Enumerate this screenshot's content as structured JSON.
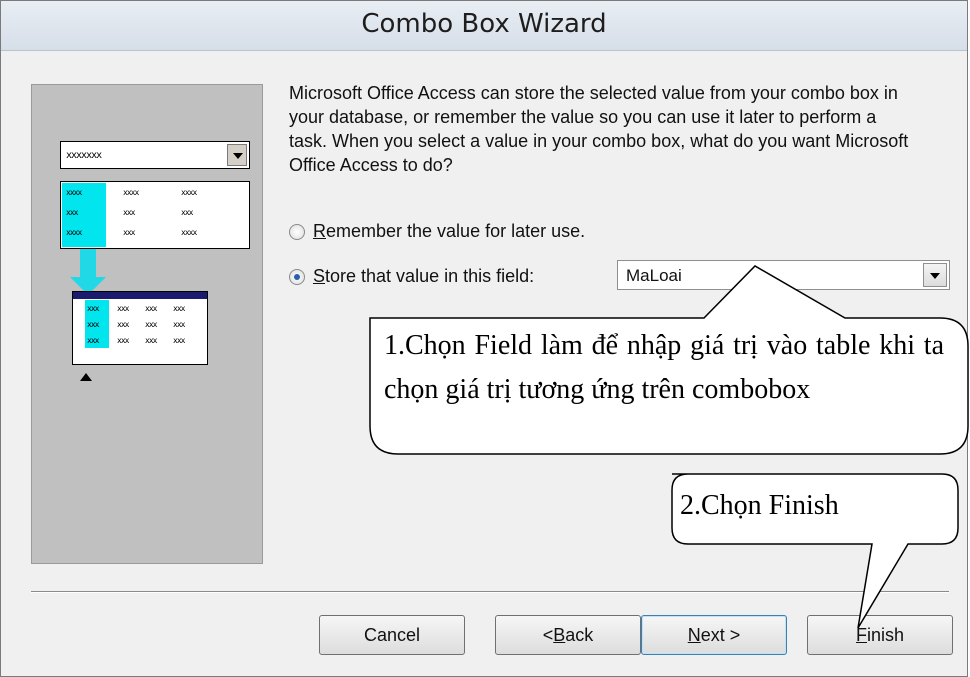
{
  "window": {
    "title": "Combo Box Wizard"
  },
  "illustration": {
    "combo_text": "xxxxxxx",
    "list_rows": [
      [
        "xxxx",
        "xxxx",
        "xxxx"
      ],
      [
        "xxx",
        "xxx",
        "xxx"
      ],
      [
        "xxxx",
        "xxx",
        "xxxx"
      ]
    ],
    "table_rows": [
      [
        "xxx",
        "xxx",
        "xxx",
        "xxx"
      ],
      [
        "xxx",
        "xxx",
        "xxx",
        "xxx"
      ],
      [
        "xxx",
        "xxx",
        "xxx",
        "xxx"
      ]
    ]
  },
  "description": "Microsoft Office Access can store the selected value from your combo box in your database, or remember the value so you can use it later to perform a task.  When you select a value in your combo box, what do you want Microsoft Office Access to do?",
  "options": {
    "remember": {
      "label_hotkey": "R",
      "label_rest": "emember the value for later use.",
      "checked": false
    },
    "store": {
      "label_hotkey": "S",
      "label_rest": "tore that value in this field:",
      "checked": true
    }
  },
  "field_select": {
    "value": "MaLoai"
  },
  "buttons": {
    "cancel": "Cancel",
    "back_prefix": "< ",
    "back_hotkey": "B",
    "back_rest": "ack",
    "next_hotkey": "N",
    "next_rest": "ext >",
    "finish_hotkey": "F",
    "finish_rest": "inish"
  },
  "callouts": {
    "field_note": "1.Chọn Field làm để nhập giá trị vào table khi ta chọn giá trị tương ứng trên combobox",
    "finish_note": "2.Chọn Finish"
  }
}
